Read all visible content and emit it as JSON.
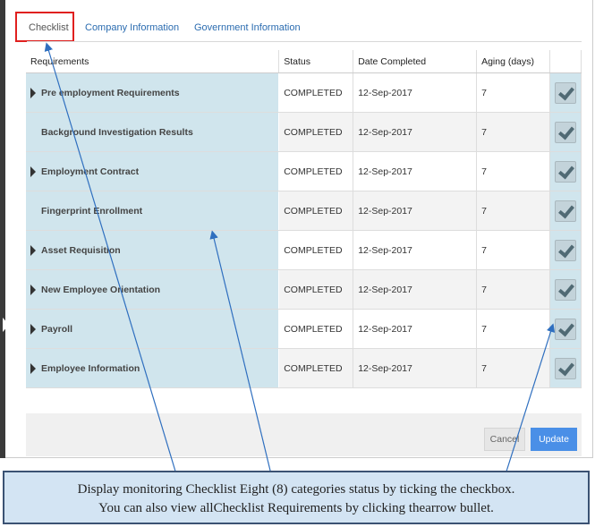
{
  "tabs": [
    {
      "label": "Checklist",
      "active": true
    },
    {
      "label": "Company Information",
      "active": false
    },
    {
      "label": "Government Information",
      "active": false
    }
  ],
  "table": {
    "headers": [
      "Requirements",
      "Status",
      "Date Completed",
      "Aging (days)",
      ""
    ],
    "rows": [
      {
        "requirement": "Pre employment Requirements",
        "has_arrow": true,
        "status": "COMPLETED",
        "date": "12-Sep-2017",
        "aging": "7",
        "checked": true
      },
      {
        "requirement": "Background Investigation Results",
        "has_arrow": false,
        "status": "COMPLETED",
        "date": "12-Sep-2017",
        "aging": "7",
        "checked": true
      },
      {
        "requirement": "Employment Contract",
        "has_arrow": true,
        "status": "COMPLETED",
        "date": "12-Sep-2017",
        "aging": "7",
        "checked": true
      },
      {
        "requirement": "Fingerprint Enrollment",
        "has_arrow": false,
        "status": "COMPLETED",
        "date": "12-Sep-2017",
        "aging": "7",
        "checked": true
      },
      {
        "requirement": "Asset Requisition",
        "has_arrow": true,
        "status": "COMPLETED",
        "date": "12-Sep-2017",
        "aging": "7",
        "checked": true
      },
      {
        "requirement": "New Employee Orientation",
        "has_arrow": true,
        "status": "COMPLETED",
        "date": "12-Sep-2017",
        "aging": "7",
        "checked": true
      },
      {
        "requirement": "Payroll",
        "has_arrow": true,
        "status": "COMPLETED",
        "date": "12-Sep-2017",
        "aging": "7",
        "checked": true
      },
      {
        "requirement": "Employee Information",
        "has_arrow": true,
        "status": "COMPLETED",
        "date": "12-Sep-2017",
        "aging": "7",
        "checked": true
      }
    ]
  },
  "footer": {
    "cancel_label": "Cancel",
    "update_label": "Update"
  },
  "annotation": {
    "line1": "Display monitoring Checklist Eight (8) categories status by ticking the checkbox.",
    "line2": "You can also view allChecklist Requirements  by clicking thearrow bullet."
  },
  "colors": {
    "accent": "#4a8fe7",
    "highlight_box": "#e0201f",
    "annotation_arrow": "#2f6fbf",
    "requirement_bg": "#d0e5ed"
  }
}
